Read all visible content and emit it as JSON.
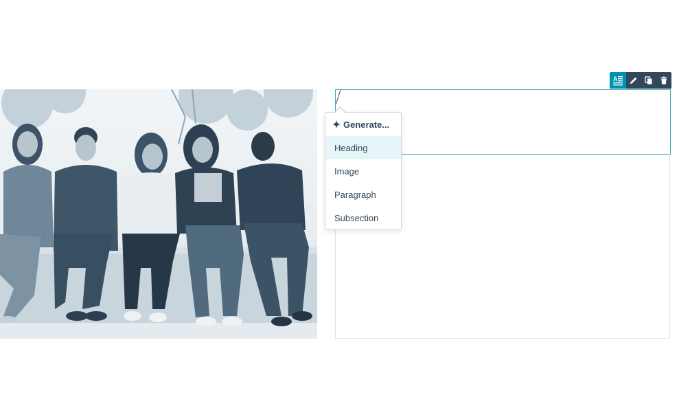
{
  "menu": {
    "generate_label": "Generate...",
    "items": [
      {
        "label": "Heading"
      },
      {
        "label": "Image"
      },
      {
        "label": "Paragraph"
      },
      {
        "label": "Subsection"
      }
    ],
    "hovered_item": "Heading"
  },
  "toolbar": {
    "icons": [
      "rich-text-icon",
      "pencil-icon",
      "duplicate-icon",
      "trash-icon"
    ],
    "active_icon": "rich-text-icon"
  },
  "colors": {
    "accent": "#0091ae",
    "selection_border": "#3aa6b0",
    "toolbar_bg": "#33475b",
    "menu_hover": "#e5f5f8",
    "text": "#33475b",
    "photo_tint": "#5b7a91"
  },
  "photo": {
    "subject": "group of five smiling young people sitting on a ledge",
    "tint": "duotone blue-gray"
  }
}
